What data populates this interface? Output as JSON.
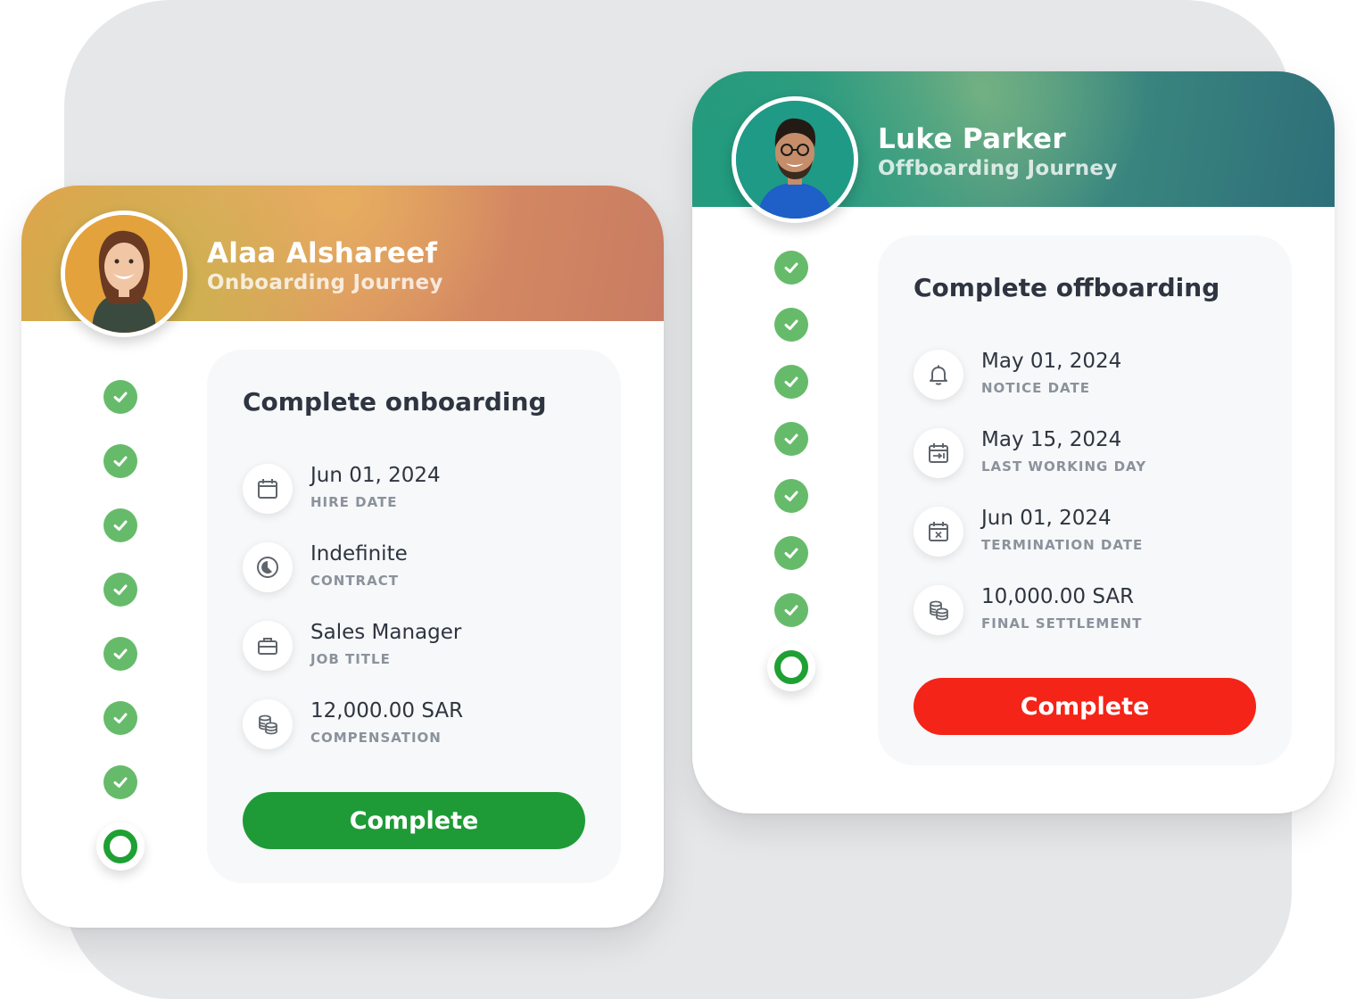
{
  "colors": {
    "background_panel": "#e6e7e9",
    "step_done": "#66bb6a",
    "step_current_ring": "#1ea033",
    "onboarding_button": "#1e9b36",
    "offboarding_button": "#f52418",
    "onboarding_header": "#e0a055",
    "offboarding_header": "#3a8f80"
  },
  "onboarding": {
    "name": "Alaa Alshareef",
    "journey": "Onboarding Journey",
    "steps_completed": 7,
    "steps_total": 8,
    "panel_title": "Complete onboarding",
    "items": [
      {
        "icon": "calendar-icon",
        "value": "Jun 01, 2024",
        "label": "HIRE DATE"
      },
      {
        "icon": "pie-chart-icon",
        "value": "Indefinite",
        "label": "CONTRACT"
      },
      {
        "icon": "briefcase-icon",
        "value": "Sales Manager",
        "label": "JOB TITLE"
      },
      {
        "icon": "coins-icon",
        "value": "12,000.00 SAR",
        "label": "COMPENSATION"
      }
    ],
    "button_label": "Complete"
  },
  "offboarding": {
    "name": "Luke Parker",
    "journey": "Offboarding Journey",
    "steps_completed": 7,
    "steps_total": 8,
    "panel_title": "Complete offboarding",
    "items": [
      {
        "icon": "bell-icon",
        "value": "May 01, 2024",
        "label": "NOTICE DATE"
      },
      {
        "icon": "calendar-arrow-icon",
        "value": "May 15, 2024",
        "label": "LAST WORKING DAY"
      },
      {
        "icon": "calendar-x-icon",
        "value": "Jun 01, 2024",
        "label": "TERMINATION DATE"
      },
      {
        "icon": "coins-icon",
        "value": "10,000.00 SAR",
        "label": "FINAL SETTLEMENT"
      }
    ],
    "button_label": "Complete"
  }
}
